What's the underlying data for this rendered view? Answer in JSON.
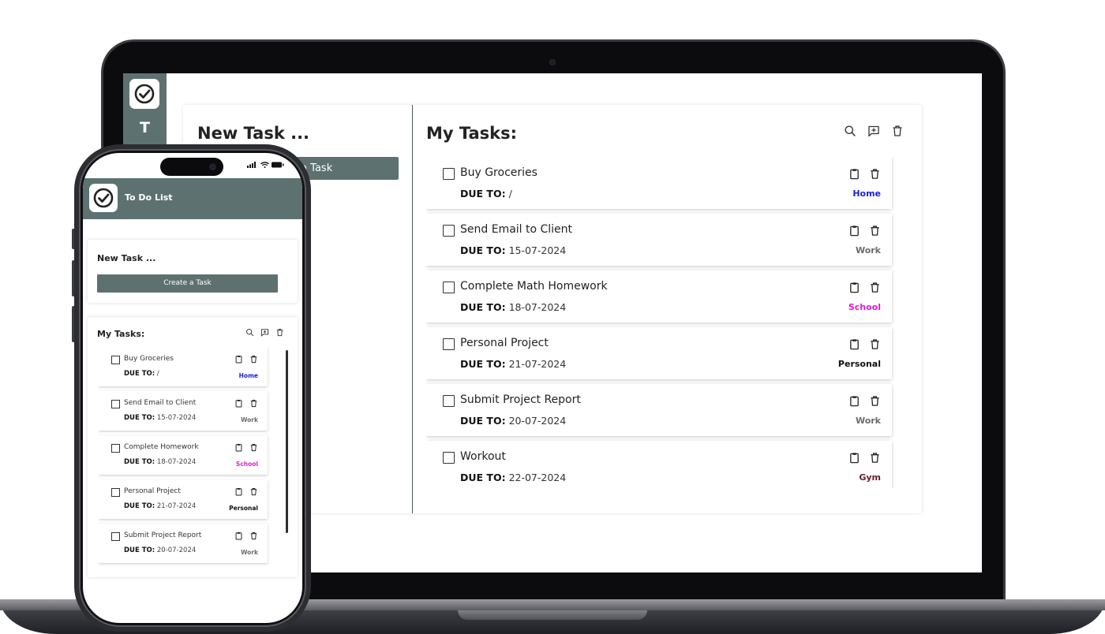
{
  "sidebar": {
    "letter": "T",
    "logo_icon": "check-circle-icon"
  },
  "desktop": {
    "new_task": {
      "title": "New Task ...",
      "create_button": "Create a Task",
      "create_button_visible_fragment": "Task"
    },
    "my_tasks": {
      "title": "My Tasks:",
      "toolbar": [
        {
          "name": "search-icon"
        },
        {
          "name": "add-comment-icon"
        },
        {
          "name": "trash-icon"
        }
      ],
      "due_label": "DUE TO:",
      "tasks": [
        {
          "title": "Buy Groceries",
          "due": "/",
          "tag": "Home",
          "tag_color": "#1a23d8"
        },
        {
          "title": "Send Email to Client",
          "due": "15-07-2024",
          "tag": "Work",
          "tag_color": "#6b6b6b"
        },
        {
          "title": "Complete Math Homework",
          "due": "18-07-2024",
          "tag": "School",
          "tag_color": "#e01cd5"
        },
        {
          "title": "Personal Project",
          "due": "21-07-2024",
          "tag": "Personal",
          "tag_color": "#111111"
        },
        {
          "title": "Submit Project Report",
          "due": "20-07-2024",
          "tag": "Work",
          "tag_color": "#6b6b6b"
        },
        {
          "title": "Workout",
          "due": "22-07-2024",
          "tag": "Gym",
          "tag_color": "#6a1b2a"
        }
      ]
    }
  },
  "mobile": {
    "app_title": "To Do List",
    "new_task": {
      "title": "New Task ...",
      "create_button": "Create a Task"
    },
    "my_tasks": {
      "title": "My Tasks:",
      "due_label": "DUE TO:",
      "tasks": [
        {
          "title": "Buy Groceries",
          "due": "/",
          "tag": "Home",
          "tag_color": "#1a23d8"
        },
        {
          "title": "Send Email to Client",
          "due": "15-07-2024",
          "tag": "Work",
          "tag_color": "#6b6b6b"
        },
        {
          "title": "Complete Homework",
          "due": "18-07-2024",
          "tag": "School",
          "tag_color": "#e01cd5"
        },
        {
          "title": "Personal Project",
          "due": "21-07-2024",
          "tag": "Personal",
          "tag_color": "#111111"
        },
        {
          "title": "Submit Project Report",
          "due": "20-07-2024",
          "tag": "Work",
          "tag_color": "#6b6b6b"
        }
      ]
    }
  },
  "colors": {
    "accent": "#5d7270",
    "divider": "#4a5b5a"
  }
}
